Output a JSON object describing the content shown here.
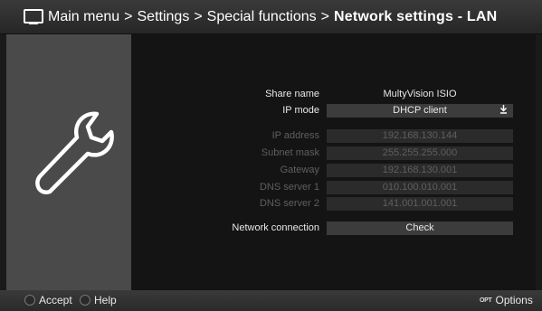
{
  "header": {
    "breadcrumb": [
      "Main menu",
      "Settings",
      "Special functions"
    ],
    "separator": ">",
    "current": "Network settings - LAN"
  },
  "left": {
    "icon": "wrench-icon"
  },
  "fields": {
    "share_name": {
      "label": "Share name",
      "value": "MultyVision ISIO"
    },
    "ip_mode": {
      "label": "IP mode",
      "value": "DHCP client",
      "icon": "download-icon"
    },
    "ip_address": {
      "label": "IP address",
      "value": "192.168.130.144"
    },
    "subnet_mask": {
      "label": "Subnet mask",
      "value": "255.255.255.000"
    },
    "gateway": {
      "label": "Gateway",
      "value": "192.168.130.001"
    },
    "dns1": {
      "label": "DNS server 1",
      "value": "010.100.010.001"
    },
    "dns2": {
      "label": "DNS server 2",
      "value": "141.001.001.001"
    },
    "network_connection": {
      "label": "Network connection",
      "value": "Check"
    }
  },
  "footer": {
    "accept": "Accept",
    "help": "Help",
    "options_badge": "OPT",
    "options": "Options"
  }
}
